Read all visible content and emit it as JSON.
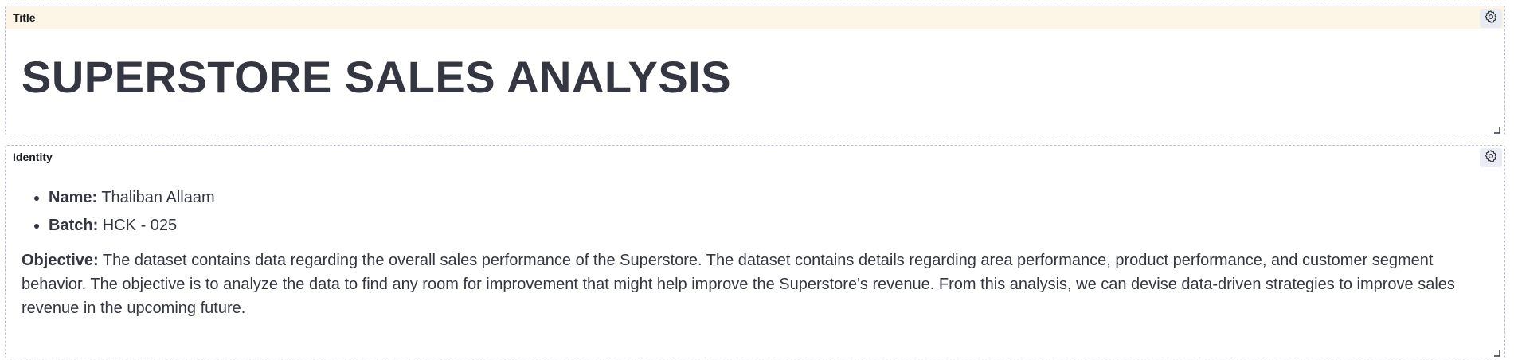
{
  "title_panel": {
    "header_label": "Title",
    "heading": "SUPERSTORE SALES ANALYSIS"
  },
  "identity_panel": {
    "header_label": "Identity",
    "items": [
      {
        "label": "Name:",
        "value": " Thaliban Allaam"
      },
      {
        "label": "Batch:",
        "value": " HCK - 025"
      }
    ],
    "objective_label": "Objective:",
    "objective_text": " The dataset contains data regarding the overall sales performance of the Superstore. The dataset contains details regarding area performance, product performance, and customer segment behavior. The objective is to analyze the data to find any room for improvement that might help improve the Superstore's revenue. From this analysis, we can devise data-driven strategies to improve sales revenue in the upcoming future."
  },
  "icons": {
    "settings": "gear-icon",
    "resize": "resize-handle-icon"
  },
  "colors": {
    "header_highlight": "#fdf6e6",
    "text": "#343741",
    "panel_border": "#b9bfd6",
    "gear_button_bg": "#e9edf3"
  }
}
